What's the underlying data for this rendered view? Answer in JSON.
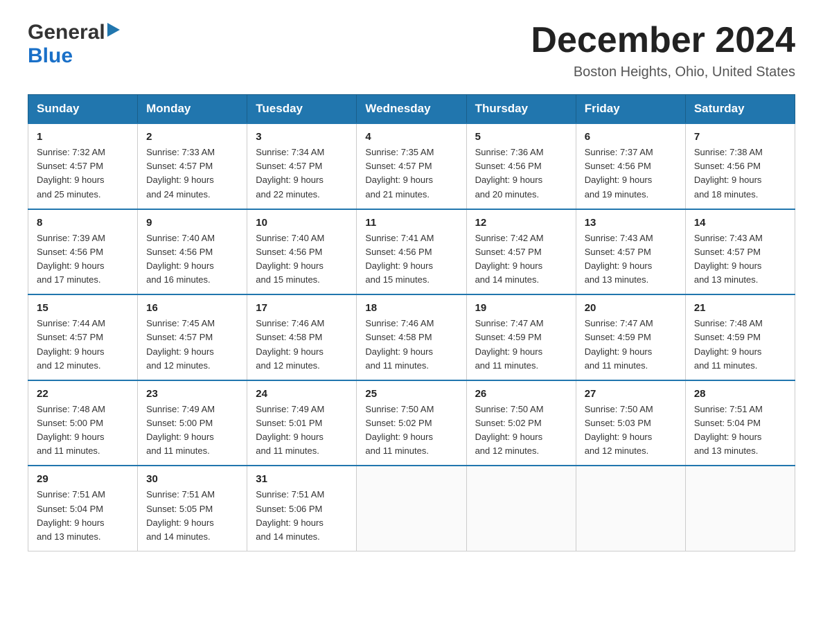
{
  "header": {
    "logo_general": "General",
    "logo_blue": "Blue",
    "month_title": "December 2024",
    "location": "Boston Heights, Ohio, United States"
  },
  "weekdays": [
    "Sunday",
    "Monday",
    "Tuesday",
    "Wednesday",
    "Thursday",
    "Friday",
    "Saturday"
  ],
  "weeks": [
    [
      {
        "day": "1",
        "sunrise": "Sunrise: 7:32 AM",
        "sunset": "Sunset: 4:57 PM",
        "daylight": "Daylight: 9 hours",
        "daylight2": "and 25 minutes."
      },
      {
        "day": "2",
        "sunrise": "Sunrise: 7:33 AM",
        "sunset": "Sunset: 4:57 PM",
        "daylight": "Daylight: 9 hours",
        "daylight2": "and 24 minutes."
      },
      {
        "day": "3",
        "sunrise": "Sunrise: 7:34 AM",
        "sunset": "Sunset: 4:57 PM",
        "daylight": "Daylight: 9 hours",
        "daylight2": "and 22 minutes."
      },
      {
        "day": "4",
        "sunrise": "Sunrise: 7:35 AM",
        "sunset": "Sunset: 4:57 PM",
        "daylight": "Daylight: 9 hours",
        "daylight2": "and 21 minutes."
      },
      {
        "day": "5",
        "sunrise": "Sunrise: 7:36 AM",
        "sunset": "Sunset: 4:56 PM",
        "daylight": "Daylight: 9 hours",
        "daylight2": "and 20 minutes."
      },
      {
        "day": "6",
        "sunrise": "Sunrise: 7:37 AM",
        "sunset": "Sunset: 4:56 PM",
        "daylight": "Daylight: 9 hours",
        "daylight2": "and 19 minutes."
      },
      {
        "day": "7",
        "sunrise": "Sunrise: 7:38 AM",
        "sunset": "Sunset: 4:56 PM",
        "daylight": "Daylight: 9 hours",
        "daylight2": "and 18 minutes."
      }
    ],
    [
      {
        "day": "8",
        "sunrise": "Sunrise: 7:39 AM",
        "sunset": "Sunset: 4:56 PM",
        "daylight": "Daylight: 9 hours",
        "daylight2": "and 17 minutes."
      },
      {
        "day": "9",
        "sunrise": "Sunrise: 7:40 AM",
        "sunset": "Sunset: 4:56 PM",
        "daylight": "Daylight: 9 hours",
        "daylight2": "and 16 minutes."
      },
      {
        "day": "10",
        "sunrise": "Sunrise: 7:40 AM",
        "sunset": "Sunset: 4:56 PM",
        "daylight": "Daylight: 9 hours",
        "daylight2": "and 15 minutes."
      },
      {
        "day": "11",
        "sunrise": "Sunrise: 7:41 AM",
        "sunset": "Sunset: 4:56 PM",
        "daylight": "Daylight: 9 hours",
        "daylight2": "and 15 minutes."
      },
      {
        "day": "12",
        "sunrise": "Sunrise: 7:42 AM",
        "sunset": "Sunset: 4:57 PM",
        "daylight": "Daylight: 9 hours",
        "daylight2": "and 14 minutes."
      },
      {
        "day": "13",
        "sunrise": "Sunrise: 7:43 AM",
        "sunset": "Sunset: 4:57 PM",
        "daylight": "Daylight: 9 hours",
        "daylight2": "and 13 minutes."
      },
      {
        "day": "14",
        "sunrise": "Sunrise: 7:43 AM",
        "sunset": "Sunset: 4:57 PM",
        "daylight": "Daylight: 9 hours",
        "daylight2": "and 13 minutes."
      }
    ],
    [
      {
        "day": "15",
        "sunrise": "Sunrise: 7:44 AM",
        "sunset": "Sunset: 4:57 PM",
        "daylight": "Daylight: 9 hours",
        "daylight2": "and 12 minutes."
      },
      {
        "day": "16",
        "sunrise": "Sunrise: 7:45 AM",
        "sunset": "Sunset: 4:57 PM",
        "daylight": "Daylight: 9 hours",
        "daylight2": "and 12 minutes."
      },
      {
        "day": "17",
        "sunrise": "Sunrise: 7:46 AM",
        "sunset": "Sunset: 4:58 PM",
        "daylight": "Daylight: 9 hours",
        "daylight2": "and 12 minutes."
      },
      {
        "day": "18",
        "sunrise": "Sunrise: 7:46 AM",
        "sunset": "Sunset: 4:58 PM",
        "daylight": "Daylight: 9 hours",
        "daylight2": "and 11 minutes."
      },
      {
        "day": "19",
        "sunrise": "Sunrise: 7:47 AM",
        "sunset": "Sunset: 4:59 PM",
        "daylight": "Daylight: 9 hours",
        "daylight2": "and 11 minutes."
      },
      {
        "day": "20",
        "sunrise": "Sunrise: 7:47 AM",
        "sunset": "Sunset: 4:59 PM",
        "daylight": "Daylight: 9 hours",
        "daylight2": "and 11 minutes."
      },
      {
        "day": "21",
        "sunrise": "Sunrise: 7:48 AM",
        "sunset": "Sunset: 4:59 PM",
        "daylight": "Daylight: 9 hours",
        "daylight2": "and 11 minutes."
      }
    ],
    [
      {
        "day": "22",
        "sunrise": "Sunrise: 7:48 AM",
        "sunset": "Sunset: 5:00 PM",
        "daylight": "Daylight: 9 hours",
        "daylight2": "and 11 minutes."
      },
      {
        "day": "23",
        "sunrise": "Sunrise: 7:49 AM",
        "sunset": "Sunset: 5:00 PM",
        "daylight": "Daylight: 9 hours",
        "daylight2": "and 11 minutes."
      },
      {
        "day": "24",
        "sunrise": "Sunrise: 7:49 AM",
        "sunset": "Sunset: 5:01 PM",
        "daylight": "Daylight: 9 hours",
        "daylight2": "and 11 minutes."
      },
      {
        "day": "25",
        "sunrise": "Sunrise: 7:50 AM",
        "sunset": "Sunset: 5:02 PM",
        "daylight": "Daylight: 9 hours",
        "daylight2": "and 11 minutes."
      },
      {
        "day": "26",
        "sunrise": "Sunrise: 7:50 AM",
        "sunset": "Sunset: 5:02 PM",
        "daylight": "Daylight: 9 hours",
        "daylight2": "and 12 minutes."
      },
      {
        "day": "27",
        "sunrise": "Sunrise: 7:50 AM",
        "sunset": "Sunset: 5:03 PM",
        "daylight": "Daylight: 9 hours",
        "daylight2": "and 12 minutes."
      },
      {
        "day": "28",
        "sunrise": "Sunrise: 7:51 AM",
        "sunset": "Sunset: 5:04 PM",
        "daylight": "Daylight: 9 hours",
        "daylight2": "and 13 minutes."
      }
    ],
    [
      {
        "day": "29",
        "sunrise": "Sunrise: 7:51 AM",
        "sunset": "Sunset: 5:04 PM",
        "daylight": "Daylight: 9 hours",
        "daylight2": "and 13 minutes."
      },
      {
        "day": "30",
        "sunrise": "Sunrise: 7:51 AM",
        "sunset": "Sunset: 5:05 PM",
        "daylight": "Daylight: 9 hours",
        "daylight2": "and 14 minutes."
      },
      {
        "day": "31",
        "sunrise": "Sunrise: 7:51 AM",
        "sunset": "Sunset: 5:06 PM",
        "daylight": "Daylight: 9 hours",
        "daylight2": "and 14 minutes."
      },
      null,
      null,
      null,
      null
    ]
  ]
}
